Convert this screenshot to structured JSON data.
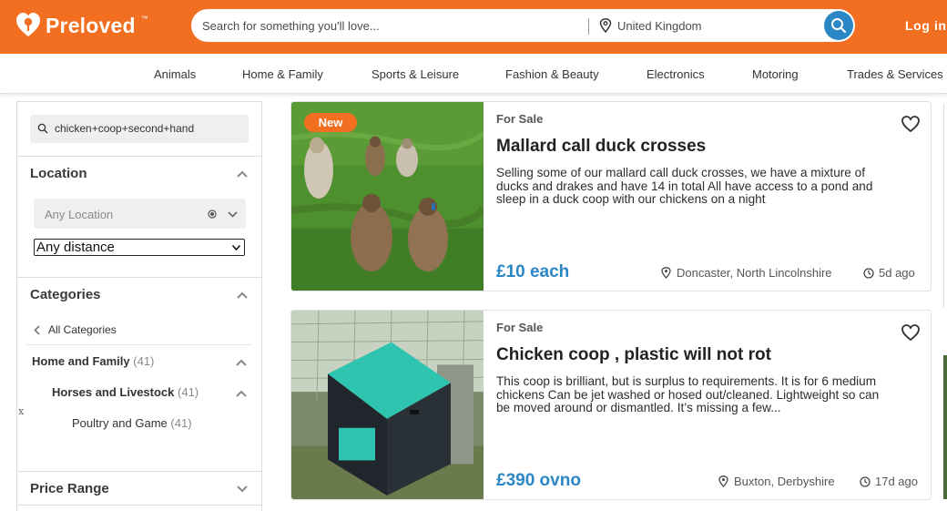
{
  "header": {
    "logo_text": "Preloved",
    "logo_tm": "™",
    "search_placeholder": "Search for something you'll love...",
    "location_text": "United Kingdom",
    "login_label": "Log in",
    "brand_color": "#f26e21",
    "accent_color": "#2a86c5"
  },
  "categories_nav": [
    "Animals",
    "Home & Family",
    "Sports & Leisure",
    "Fashion & Beauty",
    "Electronics",
    "Motoring",
    "Trades & Services"
  ],
  "sidebar": {
    "keyword": "chicken+coop+second+hand",
    "location": {
      "title": "Location",
      "placeholder": "Any Location",
      "distance": "Any distance"
    },
    "categories": {
      "title": "Categories",
      "all_label": "All Categories",
      "tree": [
        {
          "label": "Home and Family",
          "count": "(41)"
        },
        {
          "label": "Horses and Livestock",
          "count": "(41)"
        },
        {
          "label": "Poultry and Game",
          "count": "(41)"
        }
      ]
    },
    "stray_text": "x",
    "price_range_title": "Price Range"
  },
  "listings": [
    {
      "badge": "New",
      "type": "For Sale",
      "title": "Mallard call duck crosses",
      "description": "Selling some of our mallard call duck crosses, we have a mixture of ducks and drakes and have 14 in total All have access to a pond and sleep in a duck coop with our chickens on a night",
      "price": "£10 each",
      "location": "Doncaster, North Lincolnshire",
      "age": "5d ago",
      "photo": "ducks-on-grass"
    },
    {
      "badge": "",
      "type": "For Sale",
      "title": "Chicken coop , plastic will not rot",
      "description": "This coop is brilliant, but is surplus to requirements. It is for 6 medium chickens Can be jet washed or hosed out/cleaned. Lightweight so can be moved around or dismantled. It’s missing a few...",
      "price": "£390 ovno",
      "location": "Buxton, Derbyshire",
      "age": "17d ago",
      "photo": "teal-chicken-coop"
    }
  ]
}
